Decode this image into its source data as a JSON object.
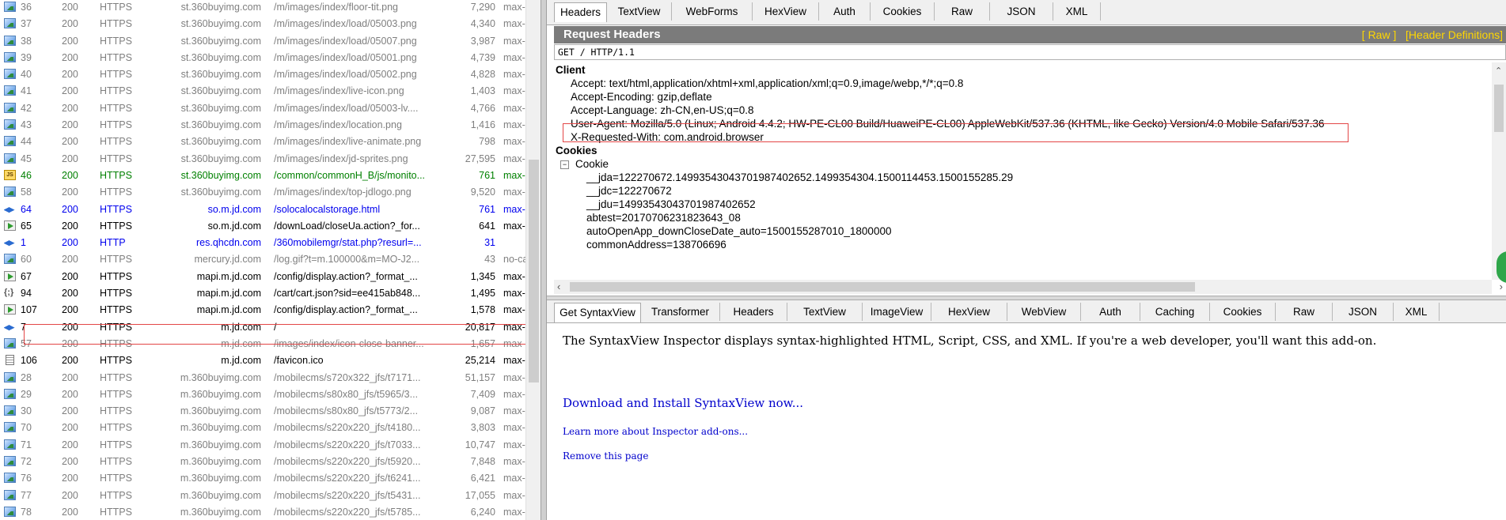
{
  "sessions": [
    {
      "icon": "image-icon",
      "num": "36",
      "result": "200",
      "protocol": "HTTPS",
      "host": "st.360buyimg.com",
      "url": "/m/images/index/floor-tit.png",
      "body": "7,290",
      "caching": "max-",
      "style": "gray"
    },
    {
      "icon": "image-icon",
      "num": "37",
      "result": "200",
      "protocol": "HTTPS",
      "host": "st.360buyimg.com",
      "url": "/m/images/index/load/05003.png",
      "body": "4,340",
      "caching": "max-",
      "style": "gray"
    },
    {
      "icon": "image-icon",
      "num": "38",
      "result": "200",
      "protocol": "HTTPS",
      "host": "st.360buyimg.com",
      "url": "/m/images/index/load/05007.png",
      "body": "3,987",
      "caching": "max-",
      "style": "gray"
    },
    {
      "icon": "image-icon",
      "num": "39",
      "result": "200",
      "protocol": "HTTPS",
      "host": "st.360buyimg.com",
      "url": "/m/images/index/load/05001.png",
      "body": "4,739",
      "caching": "max-",
      "style": "gray"
    },
    {
      "icon": "image-icon",
      "num": "40",
      "result": "200",
      "protocol": "HTTPS",
      "host": "st.360buyimg.com",
      "url": "/m/images/index/load/05002.png",
      "body": "4,828",
      "caching": "max-",
      "style": "gray"
    },
    {
      "icon": "image-icon",
      "num": "41",
      "result": "200",
      "protocol": "HTTPS",
      "host": "st.360buyimg.com",
      "url": "/m/images/index/live-icon.png",
      "body": "1,403",
      "caching": "max-",
      "style": "gray"
    },
    {
      "icon": "image-icon",
      "num": "42",
      "result": "200",
      "protocol": "HTTPS",
      "host": "st.360buyimg.com",
      "url": "/m/images/index/load/05003-lv....",
      "body": "4,766",
      "caching": "max-",
      "style": "gray"
    },
    {
      "icon": "image-icon",
      "num": "43",
      "result": "200",
      "protocol": "HTTPS",
      "host": "st.360buyimg.com",
      "url": "/m/images/index/location.png",
      "body": "1,416",
      "caching": "max-",
      "style": "gray"
    },
    {
      "icon": "image-icon",
      "num": "44",
      "result": "200",
      "protocol": "HTTPS",
      "host": "st.360buyimg.com",
      "url": "/m/images/index/live-animate.png",
      "body": "798",
      "caching": "max-",
      "style": "gray"
    },
    {
      "icon": "image-icon",
      "num": "45",
      "result": "200",
      "protocol": "HTTPS",
      "host": "st.360buyimg.com",
      "url": "/m/images/index/jd-sprites.png",
      "body": "27,595",
      "caching": "max-",
      "style": "gray"
    },
    {
      "icon": "js-icon",
      "num": "46",
      "result": "200",
      "protocol": "HTTPS",
      "host": "st.360buyimg.com",
      "url": "/common/commonH_B/js/monito...",
      "body": "761",
      "caching": "max-",
      "style": "green"
    },
    {
      "icon": "image-icon",
      "num": "58",
      "result": "200",
      "protocol": "HTTPS",
      "host": "st.360buyimg.com",
      "url": "/m/images/index/top-jdlogo.png",
      "body": "9,520",
      "caching": "max-",
      "style": "gray"
    },
    {
      "icon": "arrows-icon",
      "num": "64",
      "result": "200",
      "protocol": "HTTPS",
      "host": "so.m.jd.com",
      "url": "/solocalocalstorage.html",
      "body": "761",
      "caching": "max-",
      "style": "blue"
    },
    {
      "icon": "forward-icon",
      "num": "65",
      "result": "200",
      "protocol": "HTTPS",
      "host": "so.m.jd.com",
      "url": "/downLoad/closeUa.action?_for...",
      "body": "641",
      "caching": "max-",
      "style": "black"
    },
    {
      "icon": "arrows-icon",
      "num": "1",
      "result": "200",
      "protocol": "HTTP",
      "host": "res.qhcdn.com",
      "url": "/360mobilemgr/stat.php?resurl=...",
      "body": "31",
      "caching": "",
      "style": "blue"
    },
    {
      "icon": "image-icon",
      "num": "60",
      "result": "200",
      "protocol": "HTTPS",
      "host": "mercury.jd.com",
      "url": "/log.gif?t=m.100000&m=MO-J2...",
      "body": "43",
      "caching": "no-ca",
      "style": "gray"
    },
    {
      "icon": "forward-icon",
      "num": "67",
      "result": "200",
      "protocol": "HTTPS",
      "host": "mapi.m.jd.com",
      "url": "/config/display.action?_format_...",
      "body": "1,345",
      "caching": "max-",
      "style": "black"
    },
    {
      "icon": "json-icon",
      "num": "94",
      "result": "200",
      "protocol": "HTTPS",
      "host": "mapi.m.jd.com",
      "url": "/cart/cart.json?sid=ee415ab848...",
      "body": "1,495",
      "caching": "max-",
      "style": "black"
    },
    {
      "icon": "forward-icon",
      "num": "107",
      "result": "200",
      "protocol": "HTTPS",
      "host": "mapi.m.jd.com",
      "url": "/config/display.action?_format_...",
      "body": "1,578",
      "caching": "max-",
      "style": "black"
    },
    {
      "icon": "arrows-icon",
      "num": "7",
      "result": "200",
      "protocol": "HTTPS",
      "host": "m.jd.com",
      "url": "/",
      "body": "20,817",
      "caching": "max-",
      "style": "black"
    },
    {
      "icon": "image-icon",
      "num": "57",
      "result": "200",
      "protocol": "HTTPS",
      "host": "m.jd.com",
      "url": "/images/index/icon-close-banner...",
      "body": "1,657",
      "caching": "max-",
      "style": "gray"
    },
    {
      "icon": "doc-icon",
      "num": "106",
      "result": "200",
      "protocol": "HTTPS",
      "host": "m.jd.com",
      "url": "/favicon.ico",
      "body": "25,214",
      "caching": "max-",
      "style": "black"
    },
    {
      "icon": "image-icon",
      "num": "28",
      "result": "200",
      "protocol": "HTTPS",
      "host": "m.360buyimg.com",
      "url": "/mobilecms/s720x322_jfs/t7171...",
      "body": "51,157",
      "caching": "max-",
      "style": "gray"
    },
    {
      "icon": "image-icon",
      "num": "29",
      "result": "200",
      "protocol": "HTTPS",
      "host": "m.360buyimg.com",
      "url": "/mobilecms/s80x80_jfs/t5965/3...",
      "body": "7,409",
      "caching": "max-",
      "style": "gray"
    },
    {
      "icon": "image-icon",
      "num": "30",
      "result": "200",
      "protocol": "HTTPS",
      "host": "m.360buyimg.com",
      "url": "/mobilecms/s80x80_jfs/t5773/2...",
      "body": "9,087",
      "caching": "max-",
      "style": "gray"
    },
    {
      "icon": "image-icon",
      "num": "70",
      "result": "200",
      "protocol": "HTTPS",
      "host": "m.360buyimg.com",
      "url": "/mobilecms/s220x220_jfs/t4180...",
      "body": "3,803",
      "caching": "max-",
      "style": "gray"
    },
    {
      "icon": "image-icon",
      "num": "71",
      "result": "200",
      "protocol": "HTTPS",
      "host": "m.360buyimg.com",
      "url": "/mobilecms/s220x220_jfs/t7033...",
      "body": "10,747",
      "caching": "max-",
      "style": "gray"
    },
    {
      "icon": "image-icon",
      "num": "72",
      "result": "200",
      "protocol": "HTTPS",
      "host": "m.360buyimg.com",
      "url": "/mobilecms/s220x220_jfs/t5920...",
      "body": "7,848",
      "caching": "max-",
      "style": "gray"
    },
    {
      "icon": "image-icon",
      "num": "76",
      "result": "200",
      "protocol": "HTTPS",
      "host": "m.360buyimg.com",
      "url": "/mobilecms/s220x220_jfs/t6241...",
      "body": "6,421",
      "caching": "max-",
      "style": "gray"
    },
    {
      "icon": "image-icon",
      "num": "77",
      "result": "200",
      "protocol": "HTTPS",
      "host": "m.360buyimg.com",
      "url": "/mobilecms/s220x220_jfs/t5431...",
      "body": "17,055",
      "caching": "max-",
      "style": "gray"
    },
    {
      "icon": "image-icon",
      "num": "78",
      "result": "200",
      "protocol": "HTTPS",
      "host": "m.360buyimg.com",
      "url": "/mobilecms/s220x220_jfs/t5785...",
      "body": "6,240",
      "caching": "max-",
      "style": "gray"
    }
  ],
  "inspector_tabs": [
    "Headers",
    "TextView",
    "WebForms",
    "HexView",
    "Auth",
    "Cookies",
    "Raw",
    "JSON",
    "XML"
  ],
  "inspector_active_tab": "Headers",
  "request_headers": {
    "title": "Request Headers",
    "raw_link": "[ Raw ]",
    "definitions_link": "[Header Definitions]",
    "request_line": "GET / HTTP/1.1",
    "groups": [
      {
        "name": "Client",
        "items": [
          "Accept: text/html,application/xhtml+xml,application/xml;q=0.9,image/webp,*/*;q=0.8",
          "Accept-Encoding: gzip,deflate",
          "Accept-Language: zh-CN,en-US;q=0.8",
          "User-Agent: Mozilla/5.0 (Linux; Android 4.4.2; HW-PE-CL00 Build/HuaweiPE-CL00) AppleWebKit/537.36 (KHTML, like Gecko) Version/4.0 Mobile Safari/537.36",
          "X-Requested-With: com.android.browser"
        ]
      },
      {
        "name": "Cookies",
        "cookie_label": "Cookie",
        "cookie_toggle": "−",
        "items": [
          "__jda=122270672.1499354304370198740265​2.1499354304.1500114453.1500155285.29",
          "__jdc=122270672",
          "__jdu=1499354304370198740265​2",
          "abtest=20170706231823643_08",
          "autoOpenApp_downCloseDate_auto=1500155287010_1800000",
          "commonAddress=138706696"
        ]
      }
    ]
  },
  "response_tabs": [
    "Get SyntaxView",
    "Transformer",
    "Headers",
    "TextView",
    "ImageView",
    "HexView",
    "WebView",
    "Auth",
    "Caching",
    "Cookies",
    "Raw",
    "JSON",
    "XML"
  ],
  "response_active_tab": "Get SyntaxView",
  "syntax_view": {
    "intro": "The SyntaxView Inspector displays syntax-highlighted HTML, Script, CSS, and XML. If you're a web developer, you'll want this add-on.",
    "download_link": "Download and Install SyntaxView now...",
    "learn_link": "Learn more about Inspector add-ons...",
    "remove_link": "Remove this page"
  }
}
